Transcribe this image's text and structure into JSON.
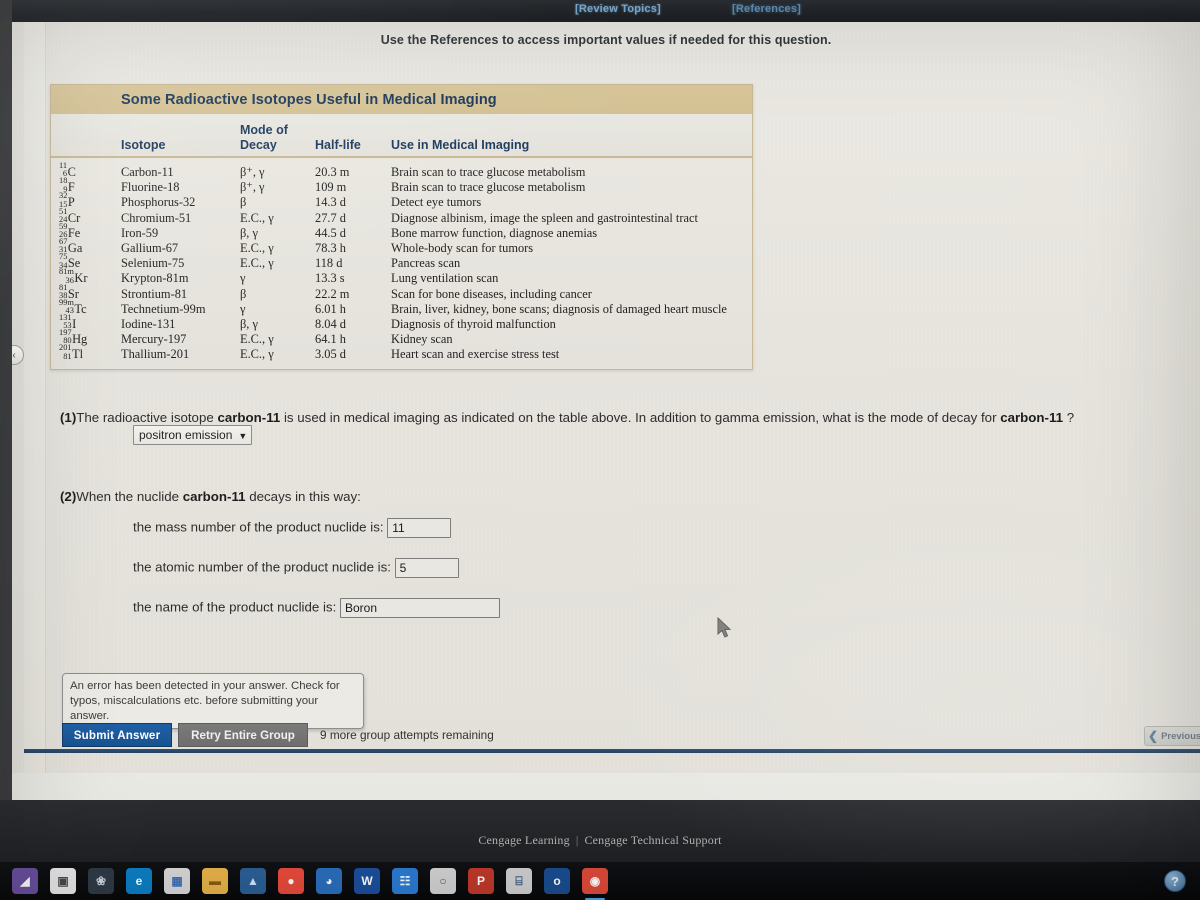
{
  "topbar": {
    "review_topics_label": "[Review Topics]",
    "references_label": "[References]",
    "instruction": "Use the References to access important values if needed for this question."
  },
  "isotope_table": {
    "title": "Some Radioactive Isotopes Useful in Medical Imaging",
    "columns": {
      "symbol": "",
      "isotope": "Isotope",
      "mode_of_decay": "Mode of\nDecay",
      "mode_line1": "Mode of",
      "mode_line2": "Decay",
      "half_life": "Half-life",
      "use": "Use in Medical Imaging"
    },
    "rows": [
      {
        "mass": "11",
        "atomic": "6",
        "element": "C",
        "isotope": "Carbon-11",
        "mode": "β⁺, γ",
        "half_life": "20.3 m",
        "use": "Brain scan to trace glucose metabolism"
      },
      {
        "mass": "18",
        "atomic": "9",
        "element": "F",
        "isotope": "Fluorine-18",
        "mode": "β⁺, γ",
        "half_life": "109 m",
        "use": "Brain scan to trace glucose metabolism"
      },
      {
        "mass": "32",
        "atomic": "15",
        "element": "P",
        "isotope": "Phosphorus-32",
        "mode": "β",
        "half_life": "14.3 d",
        "use": "Detect eye tumors"
      },
      {
        "mass": "51",
        "atomic": "24",
        "element": "Cr",
        "isotope": "Chromium-51",
        "mode": "E.C., γ",
        "half_life": "27.7 d",
        "use": "Diagnose albinism, image the spleen and gastrointestinal tract"
      },
      {
        "mass": "59",
        "atomic": "26",
        "element": "Fe",
        "isotope": "Iron-59",
        "mode": "β, γ",
        "half_life": "44.5 d",
        "use": "Bone marrow function, diagnose anemias"
      },
      {
        "mass": "67",
        "atomic": "31",
        "element": "Ga",
        "isotope": "Gallium-67",
        "mode": "E.C., γ",
        "half_life": "78.3 h",
        "use": "Whole-body scan for tumors"
      },
      {
        "mass": "75",
        "atomic": "34",
        "element": "Se",
        "isotope": "Selenium-75",
        "mode": "E.C., γ",
        "half_life": "118 d",
        "use": "Pancreas scan"
      },
      {
        "mass": "81m",
        "atomic": "36",
        "element": "Kr",
        "isotope": "Krypton-81m",
        "mode": "γ",
        "half_life": "13.3 s",
        "use": "Lung ventilation scan"
      },
      {
        "mass": "81",
        "atomic": "38",
        "element": "Sr",
        "isotope": "Strontium-81",
        "mode": "β",
        "half_life": "22.2 m",
        "use": "Scan for bone diseases, including cancer"
      },
      {
        "mass": "99m",
        "atomic": "43",
        "element": "Tc",
        "isotope": "Technetium-99m",
        "mode": "γ",
        "half_life": "6.01 h",
        "use": "Brain, liver, kidney, bone scans; diagnosis of damaged heart muscle"
      },
      {
        "mass": "131",
        "atomic": "53",
        "element": "I",
        "isotope": "Iodine-131",
        "mode": "β, γ",
        "half_life": "8.04 d",
        "use": "Diagnosis of thyroid malfunction"
      },
      {
        "mass": "197",
        "atomic": "80",
        "element": "Hg",
        "isotope": "Mercury-197",
        "mode": "E.C., γ",
        "half_life": "64.1 h",
        "use": "Kidney scan"
      },
      {
        "mass": "201",
        "atomic": "81",
        "element": "Tl",
        "isotope": "Thallium-201",
        "mode": "E.C., γ",
        "half_life": "3.05 d",
        "use": "Heart scan and exercise stress test"
      }
    ]
  },
  "question1": {
    "number": "(1)",
    "text_part1": "The radioactive isotope ",
    "isotope_bold": "carbon-11",
    "text_part2": " is used in medical imaging as indicated on the table above. In addition to gamma emission, what is the mode of decay for ",
    "isotope_bold2": "carbon-11",
    "text_part3": " ?",
    "select_value": "positron emission",
    "select_options": [
      "positron emission"
    ]
  },
  "question2": {
    "number": "(2)",
    "text_part1": "When the nuclide ",
    "isotope_bold": "carbon-11",
    "text_part2": " decays in this way:",
    "mass_label": "the mass number of the product nuclide is:",
    "mass_value": "11",
    "atomic_label": "the atomic number of the product nuclide is:",
    "atomic_value": "5",
    "name_label": "the name of the product nuclide is:",
    "name_value": "Boron"
  },
  "feedback": {
    "error_message": "An error has been detected in your answer. Check for typos, miscalculations etc. before submitting your answer."
  },
  "actions": {
    "submit_label": "Submit Answer",
    "retry_label": "Retry Entire Group",
    "attempts_text": "9 more group attempts remaining",
    "previous_label": "Previous"
  },
  "footer": {
    "brand": "Cengage Learning",
    "separator": "|",
    "support": "Cengage Technical Support"
  },
  "taskbar": {
    "icons": [
      {
        "name": "start-icon",
        "glyph": "◢",
        "bg": "#6a4fa0",
        "fg": "#ffffff"
      },
      {
        "name": "photos-icon",
        "glyph": "▣",
        "bg": "#e9e9e9",
        "fg": "#4a4a4a"
      },
      {
        "name": "paint-icon",
        "glyph": "❀",
        "bg": "#2f3a46",
        "fg": "#cfd8e0"
      },
      {
        "name": "edge-browser-icon",
        "glyph": "e",
        "bg": "#0b7fc4",
        "fg": "#ffffff"
      },
      {
        "name": "store-icon",
        "glyph": "▦",
        "bg": "#d8d8d8",
        "fg": "#3b6fb5"
      },
      {
        "name": "file-explorer-icon",
        "glyph": "▬",
        "bg": "#e8b44a",
        "fg": "#8a5c10"
      },
      {
        "name": "photos-app-icon",
        "glyph": "▲",
        "bg": "#2c5f96",
        "fg": "#cfe6ff"
      },
      {
        "name": "chrome-icon",
        "glyph": "●",
        "bg": "#e84b3c",
        "fg": "#ffffff"
      },
      {
        "name": "power-bi-icon",
        "glyph": "◕",
        "bg": "#2a6fbd",
        "fg": "#ffffff"
      },
      {
        "name": "word-icon",
        "glyph": "W",
        "bg": "#1b4f9c",
        "fg": "#ffffff"
      },
      {
        "name": "calendar-icon",
        "glyph": "☷",
        "bg": "#2b7cd3",
        "fg": "#ffffff"
      },
      {
        "name": "disc-icon",
        "glyph": "○",
        "bg": "#d2d2d2",
        "fg": "#555555"
      },
      {
        "name": "powerpoint-icon",
        "glyph": "P",
        "bg": "#c0392b",
        "fg": "#ffffff"
      },
      {
        "name": "calculator-icon",
        "glyph": "⌸",
        "bg": "#cfcfcf",
        "fg": "#3c5a80"
      },
      {
        "name": "outlook-icon",
        "glyph": "o",
        "bg": "#1a4d8f",
        "fg": "#ffffff"
      },
      {
        "name": "chrome-active-icon",
        "glyph": "◉",
        "bg": "#de4a3a",
        "fg": "#ffffff"
      }
    ],
    "help_tray_glyph": "?"
  },
  "panel_handle": {
    "glyph": "‹"
  }
}
